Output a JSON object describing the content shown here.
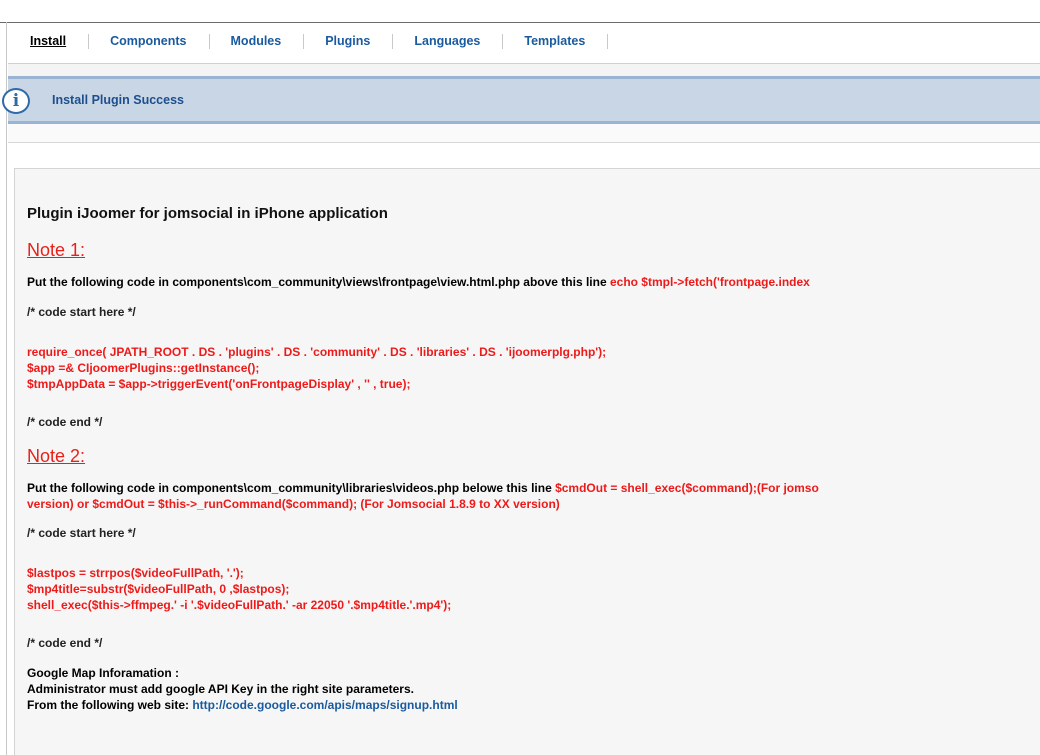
{
  "tabs": [
    {
      "label": "Install"
    },
    {
      "label": "Components"
    },
    {
      "label": "Modules"
    },
    {
      "label": "Plugins"
    },
    {
      "label": "Languages"
    },
    {
      "label": "Templates"
    }
  ],
  "notice": {
    "text": "Install Plugin Success",
    "icon": "info-icon"
  },
  "content": {
    "heading": "Plugin iJoomer for jomsocial in iPhone application",
    "note1": {
      "title": "Note 1:",
      "intro": "Put the following code in components\\com_community\\views\\frontpage\\view.html.php above this line ",
      "intro_code": "echo $tmpl->fetch('frontpage.index",
      "code_start": "/* code start here */",
      "code": [
        "require_once( JPATH_ROOT . DS . 'plugins' . DS . 'community' . DS . 'libraries' . DS . 'ijoomerplg.php');",
        "$app =& CIjoomerPlugins::getInstance();",
        "$tmpAppData = $app->triggerEvent('onFrontpageDisplay' , '' , true);"
      ],
      "code_end": "/* code end */"
    },
    "note2": {
      "title": "Note 2:",
      "intro": "Put the following code in components\\com_community\\libraries\\videos.php belowe this line ",
      "intro_code": "$cmdOut = shell_exec($command);(For jomso",
      "intro_line2": "version) or $cmdOut = $this->_runCommand($command); (For Jomsocial 1.8.9 to XX version)",
      "code_start": "/* code start here */",
      "code": [
        "$lastpos = strrpos($videoFullPath, '.');",
        "$mp4title=substr($videoFullPath, 0 ,$lastpos);",
        "shell_exec($this->ffmpeg.' -i '.$videoFullPath.' -ar 22050 '.$mp4title.'.mp4');"
      ],
      "code_end": "/* code end */"
    },
    "google": {
      "line1": "Google Map Inforamation :",
      "line2": "Administrator must add google API Key in the right site parameters.",
      "line3_prefix": "From the following web site: ",
      "line3_link": "http://code.google.com/apis/maps/signup.html"
    }
  }
}
